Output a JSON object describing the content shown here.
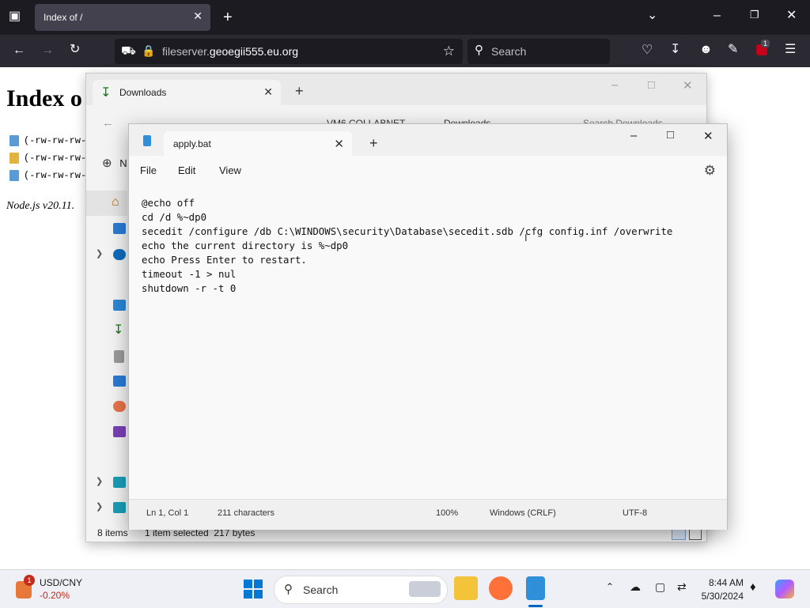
{
  "browser": {
    "tab_title": "Index of /",
    "url_host_prefix": "fileserver.",
    "url_host_main": "geoegii555.eu.org",
    "search_placeholder": "Search",
    "extension_badge": "1"
  },
  "page": {
    "heading": "Index o",
    "rows": [
      "(-rw-rw-rw-",
      "(-rw-rw-rw-",
      "(-rw-rw-rw-"
    ],
    "footer": "Node.js v20.11."
  },
  "explorer": {
    "tab_label": "Downloads",
    "breadcrumb_pc": "VM6 COLLABNET",
    "breadcrumb_folder": "Downloads",
    "search_placeholder": "Search Downloads",
    "new_label": "N",
    "item_count": "8 items",
    "selection_info": "1 item selected  217 bytes"
  },
  "notepad": {
    "tab_label": "apply.bat",
    "menu": [
      "File",
      "Edit",
      "View"
    ],
    "content": "@echo off\ncd /d %~dp0\nsecedit /configure /db C:\\WINDOWS\\security\\Database\\secedit.sdb /cfg config.inf /overwrite\necho the current directory is %~dp0\necho Press Enter to restart.\ntimeout -1 > nul\nshutdown -r -t 0",
    "status": {
      "position": "Ln 1, Col 1",
      "characters": "211 characters",
      "zoom": "100%",
      "line_endings": "Windows (CRLF)",
      "encoding": "UTF-8"
    }
  },
  "taskbar": {
    "widget_title": "USD/CNY",
    "widget_value": "-0.20%",
    "widget_badge": "1",
    "search_label": "Search",
    "time": "8:44 AM",
    "date": "5/30/2024"
  },
  "colors": {
    "firefox_bg": "#1c1b22",
    "negative": "#c42b1c",
    "accent": "#0067c0"
  }
}
